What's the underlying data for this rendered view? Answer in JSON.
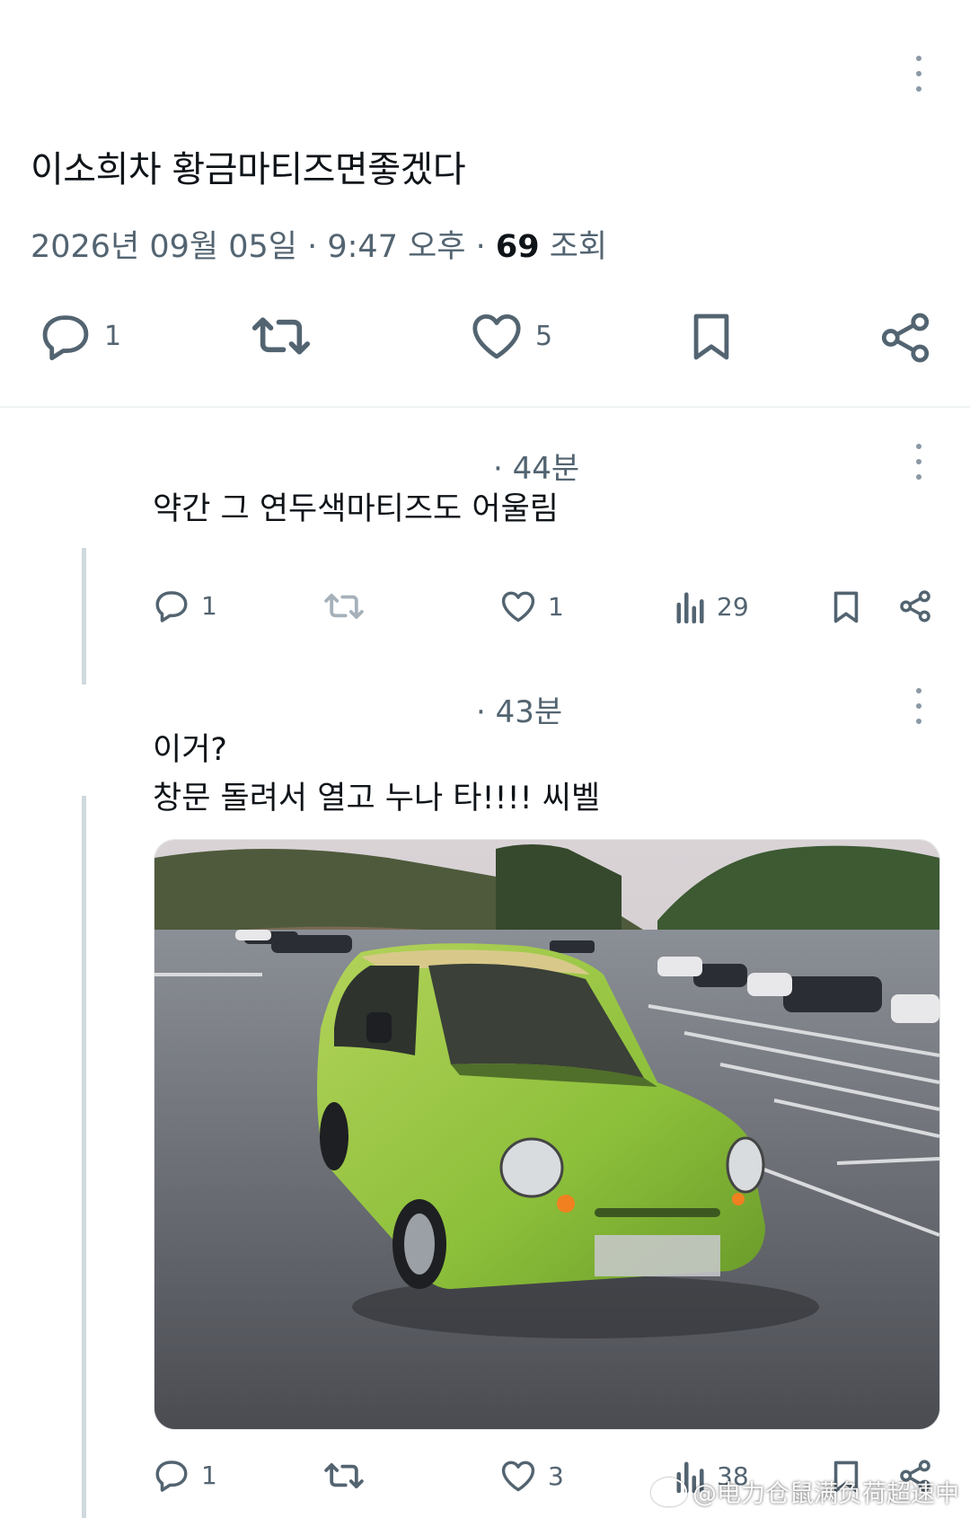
{
  "post": {
    "text": "이소희차 황금마티즈면좋겠다",
    "date": "2026년 09월 05일 · 9:47 오후 · ",
    "views_count": "69",
    "views_label": " 조회",
    "replies": "1",
    "likes": "5"
  },
  "replies": [
    {
      "time": "· 44분",
      "text": "약간 그 연두색마티즈도 어울림",
      "replies": "1",
      "likes": "1",
      "views": "29"
    },
    {
      "time": "· 43분",
      "text_line1": "이거?",
      "text_line2": "창문 돌려서 열고 누나 타!!!! 씨벨",
      "image_desc": "green compact car in parking lot",
      "replies": "1",
      "likes": "3",
      "views": "38"
    }
  ],
  "watermark": "@电力仓鼠满负荷超速中",
  "colors": {
    "text": "#0f1419",
    "muted": "#536471",
    "border": "#eff3f4",
    "car": "#8cbf3a"
  }
}
